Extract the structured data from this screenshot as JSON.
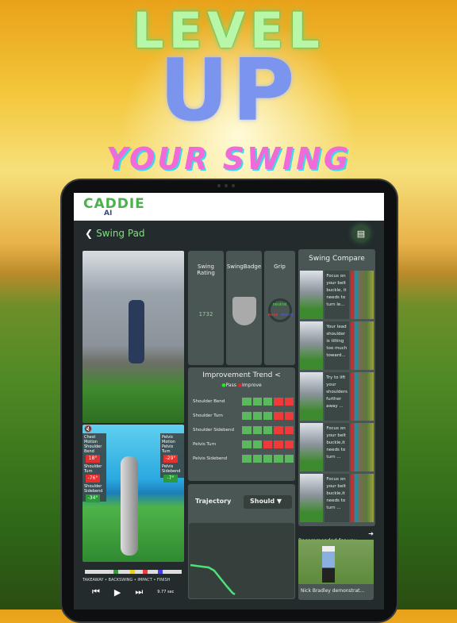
{
  "promo": {
    "line1": "LEVEL",
    "line2": "UP",
    "line3": "YOUR SWING"
  },
  "app": {
    "logo": "CADDIE",
    "logo_sub": "AI",
    "page_title": "Swing Pad",
    "back_icon": "chevron-left",
    "chat_icon": "chat-bubble"
  },
  "video": {
    "phase_labels": "TAKEAWAY • BACKSWING • IMPACT • FINISH",
    "duration": "9.77 sec",
    "mute_icon": "speaker-muted"
  },
  "chest_motion": {
    "title": "Chest Motion",
    "items": [
      {
        "label": "Shoulder Bend",
        "value": "18°",
        "status": "improve"
      },
      {
        "label": "Shoulder Turn",
        "value": "-76°",
        "status": "improve"
      },
      {
        "label": "Shoulder Sidebend",
        "value": "-34°",
        "status": "pass"
      }
    ]
  },
  "pelvic_motion": {
    "title": "Pelvic Motion",
    "items": [
      {
        "label": "Pelvis Turn",
        "value": "-29°",
        "status": "improve"
      },
      {
        "label": "Pelvis Sidebend",
        "value": "-7°",
        "status": "pass"
      }
    ]
  },
  "stats": {
    "swing_rating_label": "Swing Rating",
    "swing_rating": "1732",
    "badge_label": "SwingBadge",
    "grip_label": "Grip",
    "grip_neutral": "neutral",
    "grip_weak": "weak",
    "grip_strong": "strong"
  },
  "trend": {
    "title": "Improvement Trend",
    "pass": "Pass",
    "improve": "Improve",
    "rows": [
      {
        "label": "Shoulder Bend",
        "cells": [
          "p",
          "p",
          "p",
          "i",
          "i"
        ]
      },
      {
        "label": "Shoulder Turn",
        "cells": [
          "p",
          "p",
          "p",
          "i",
          "i"
        ]
      },
      {
        "label": "Shoulder Sidebend",
        "cells": [
          "p",
          "p",
          "p",
          "i",
          "i"
        ]
      },
      {
        "label": "Pelvis Turn",
        "cells": [
          "p",
          "p",
          "i",
          "i",
          "i"
        ]
      },
      {
        "label": "Pelvis Sidebend",
        "cells": [
          "p",
          "p",
          "p",
          "p",
          "p"
        ]
      }
    ]
  },
  "trajectory": {
    "title": "Trajectory",
    "selected": "Should"
  },
  "compare": {
    "title": "Swing Compare",
    "items": [
      "Focus on your belt buckle, it needs to turn le...",
      "Your lead shoulder is tilting too much toward...",
      "Try to lift your shoulders further away ...",
      "Focus on your belt buckle,it needs to turn ...",
      "Focus on your belt buckle,it needs to turn ..."
    ]
  },
  "recommended": {
    "title": "Recommended for you",
    "video_title": "Nick Bradley demonstrat..."
  },
  "colors": {
    "pass": "#5cb85c",
    "improve": "#f03a3a",
    "accent": "#7ee07e"
  }
}
